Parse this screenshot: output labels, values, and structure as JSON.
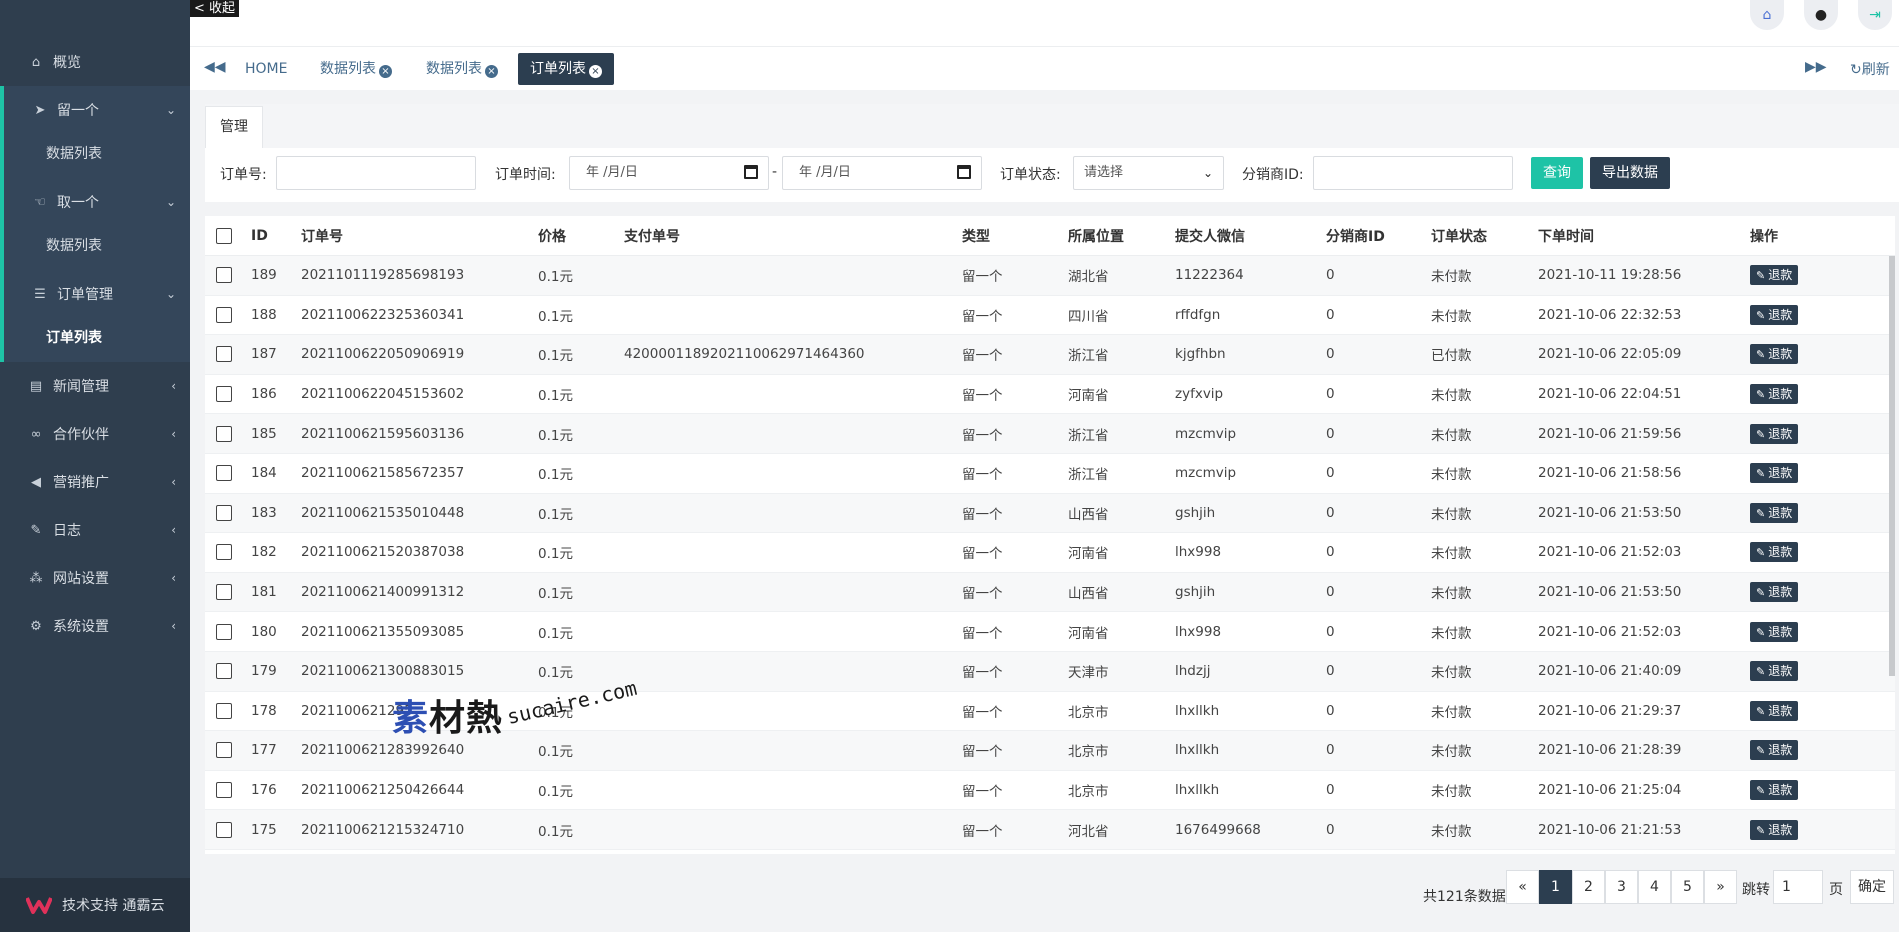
{
  "sidebar": {
    "overview": "概览",
    "groups": [
      {
        "label": "留一个",
        "sub": "数据列表",
        "icon": "paper-plane-icon"
      },
      {
        "label": "取一个",
        "sub": "数据列表",
        "icon": "hand-icon"
      },
      {
        "label": "订单管理",
        "sub": "订单列表",
        "icon": "list-icon"
      }
    ],
    "items": [
      {
        "label": "新闻管理",
        "icon": "newspaper-icon"
      },
      {
        "label": "合作伙伴",
        "icon": "handshake-icon"
      },
      {
        "label": "营销推广",
        "icon": "bullhorn-icon"
      },
      {
        "label": "日志",
        "icon": "edit-icon"
      },
      {
        "label": "网站设置",
        "icon": "sitemap-icon"
      },
      {
        "label": "系统设置",
        "icon": "gear-icon"
      }
    ],
    "footer": "技术支持 通霸云"
  },
  "topbar": {
    "collapse": "< 收起"
  },
  "tabs": {
    "home": "HOME",
    "items": [
      "数据列表",
      "数据列表",
      "订单列表"
    ],
    "refresh": "刷新"
  },
  "panel": {
    "tab": "管理",
    "filters": {
      "order_no_label": "订单号:",
      "order_time_label": "订单时间:",
      "date_placeholder": "年 /月/日",
      "dash": "-",
      "status_label": "订单状态:",
      "status_value": "请选择",
      "dist_label": "分销商ID:",
      "query": "查询",
      "export": "导出数据"
    }
  },
  "table": {
    "headers": [
      "ID",
      "订单号",
      "价格",
      "支付单号",
      "类型",
      "所属位置",
      "提交人微信",
      "分销商ID",
      "订单状态",
      "下单时间",
      "操作"
    ],
    "action_label": "退款",
    "rows": [
      {
        "id": "189",
        "no": "2021101119285698193",
        "price": "0.1元",
        "pay": "",
        "type": "留一个",
        "loc": "湖北省",
        "wx": "11222364",
        "dist": "0",
        "status": "未付款",
        "time": "2021-10-11 19:28:56"
      },
      {
        "id": "188",
        "no": "2021100622325360341",
        "price": "0.1元",
        "pay": "",
        "type": "留一个",
        "loc": "四川省",
        "wx": "rffdfgn",
        "dist": "0",
        "status": "未付款",
        "time": "2021-10-06 22:32:53"
      },
      {
        "id": "187",
        "no": "2021100622050906919",
        "price": "0.1元",
        "pay": "4200001189202110062971464360",
        "type": "留一个",
        "loc": "浙江省",
        "wx": "kjgfhbn",
        "dist": "0",
        "status": "已付款",
        "time": "2021-10-06 22:05:09"
      },
      {
        "id": "186",
        "no": "2021100622045153602",
        "price": "0.1元",
        "pay": "",
        "type": "留一个",
        "loc": "河南省",
        "wx": "zyfxvip",
        "dist": "0",
        "status": "未付款",
        "time": "2021-10-06 22:04:51"
      },
      {
        "id": "185",
        "no": "2021100621595603136",
        "price": "0.1元",
        "pay": "",
        "type": "留一个",
        "loc": "浙江省",
        "wx": "mzcmvip",
        "dist": "0",
        "status": "未付款",
        "time": "2021-10-06 21:59:56"
      },
      {
        "id": "184",
        "no": "2021100621585672357",
        "price": "0.1元",
        "pay": "",
        "type": "留一个",
        "loc": "浙江省",
        "wx": "mzcmvip",
        "dist": "0",
        "status": "未付款",
        "time": "2021-10-06 21:58:56"
      },
      {
        "id": "183",
        "no": "2021100621535010448",
        "price": "0.1元",
        "pay": "",
        "type": "留一个",
        "loc": "山西省",
        "wx": "gshjih",
        "dist": "0",
        "status": "未付款",
        "time": "2021-10-06 21:53:50"
      },
      {
        "id": "182",
        "no": "2021100621520387038",
        "price": "0.1元",
        "pay": "",
        "type": "留一个",
        "loc": "河南省",
        "wx": "lhx998",
        "dist": "0",
        "status": "未付款",
        "time": "2021-10-06 21:52:03"
      },
      {
        "id": "181",
        "no": "2021100621400991312",
        "price": "0.1元",
        "pay": "",
        "type": "留一个",
        "loc": "山西省",
        "wx": "gshjih",
        "dist": "0",
        "status": "未付款",
        "time": "2021-10-06 21:53:50"
      },
      {
        "id": "180",
        "no": "2021100621355093085",
        "price": "0.1元",
        "pay": "",
        "type": "留一个",
        "loc": "河南省",
        "wx": "lhx998",
        "dist": "0",
        "status": "未付款",
        "time": "2021-10-06 21:52:03"
      },
      {
        "id": "179",
        "no": "2021100621300883015",
        "price": "0.1元",
        "pay": "",
        "type": "留一个",
        "loc": "天津市",
        "wx": "lhdzjj",
        "dist": "0",
        "status": "未付款",
        "time": "2021-10-06 21:40:09"
      },
      {
        "id": "178",
        "no": "2021100621295",
        "price": "0.1元",
        "pay": "",
        "type": "留一个",
        "loc": "北京市",
        "wx": "lhxllkh",
        "dist": "0",
        "status": "未付款",
        "time": "2021-10-06 21:29:37"
      },
      {
        "id": "177",
        "no": "2021100621283992640",
        "price": "0.1元",
        "pay": "",
        "type": "留一个",
        "loc": "北京市",
        "wx": "lhxllkh",
        "dist": "0",
        "status": "未付款",
        "time": "2021-10-06 21:28:39"
      },
      {
        "id": "176",
        "no": "2021100621250426644",
        "price": "0.1元",
        "pay": "",
        "type": "留一个",
        "loc": "北京市",
        "wx": "lhxllkh",
        "dist": "0",
        "status": "未付款",
        "time": "2021-10-06 21:25:04"
      },
      {
        "id": "175",
        "no": "2021100621215324710",
        "price": "0.1元",
        "pay": "",
        "type": "留一个",
        "loc": "河北省",
        "wx": "1676499668",
        "dist": "0",
        "status": "未付款",
        "time": "2021-10-06 21:21:53"
      }
    ]
  },
  "watermark": {
    "cn_first": "素",
    "cn_rest": "材熱",
    "en": "sucaire.com"
  },
  "pagination": {
    "total": "共121条数据",
    "prev": "«",
    "next": "»",
    "pages": [
      "1",
      "2",
      "3",
      "4",
      "5"
    ],
    "jump_label": "跳转",
    "jump_value": "1",
    "page_unit": "页",
    "confirm": "确定"
  },
  "colors": {
    "sidebar": "#2f3e4e",
    "accent": "#1ec3a6",
    "dark": "#2c3e50"
  }
}
